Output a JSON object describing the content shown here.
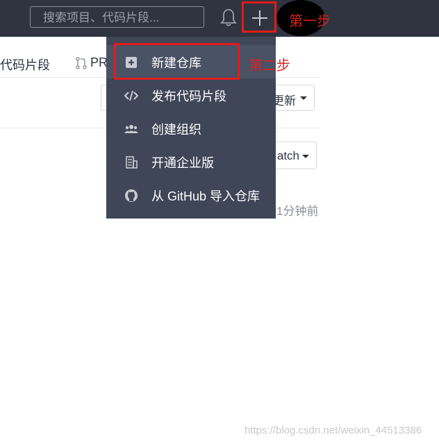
{
  "navbar": {
    "search_placeholder": "搜索项目、代码片段..."
  },
  "annotations": {
    "step1": "第一步",
    "step2": "第二步",
    "highlight_color": "#e21b1b"
  },
  "background_page": {
    "tab_snippets": "代码片段",
    "tab_pr": "PR",
    "sort_button": "更新",
    "watch_button": "atch",
    "time_text": "1分钟前"
  },
  "dropdown": {
    "items": [
      {
        "label": "新建仓库",
        "icon": "plus-square-icon"
      },
      {
        "label": "发布代码片段",
        "icon": "code-icon"
      },
      {
        "label": "创建组织",
        "icon": "users-icon"
      },
      {
        "label": "开通企业版",
        "icon": "building-icon"
      },
      {
        "label": "从 GitHub 导入仓库",
        "icon": "github-icon"
      }
    ]
  },
  "watermark": "https://blog.csdn.net/weixin_44513386",
  "colors": {
    "navbar": "#2f3440",
    "dropdown": "#3f4658"
  }
}
